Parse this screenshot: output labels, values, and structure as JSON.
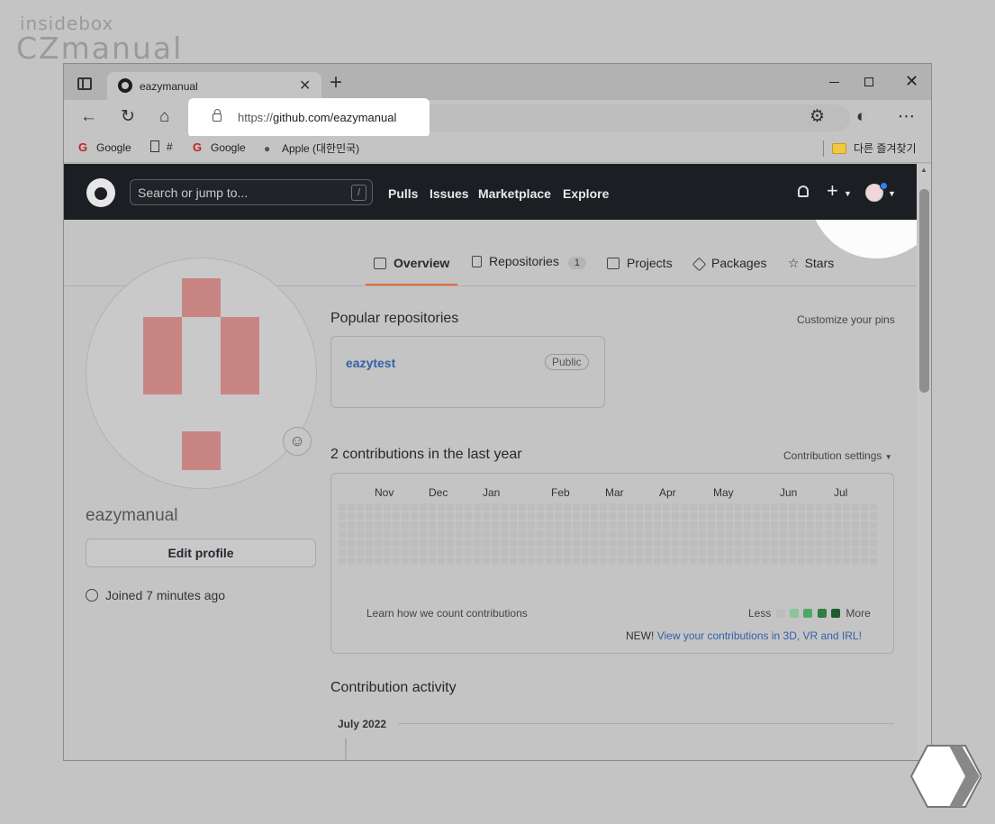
{
  "watermark": {
    "small": "insidebox",
    "big": "CZmanual"
  },
  "browser": {
    "tab_title": "eazymanual",
    "url_prefix": "https://",
    "url_host": "github.com/eazymanual",
    "bookmarks": [
      "Google",
      "#",
      "Google",
      "Apple (대한민국)"
    ],
    "other_favorites": "다른 즐겨찾기"
  },
  "github": {
    "search_placeholder": "Search or jump to...",
    "slash_key": "/",
    "nav": [
      "Pulls",
      "Issues",
      "Marketplace",
      "Explore"
    ],
    "tabs": {
      "overview": "Overview",
      "repositories": "Repositories",
      "repositories_count": "1",
      "projects": "Projects",
      "packages": "Packages",
      "stars": "Stars"
    },
    "profile": {
      "username": "eazymanual",
      "edit_button": "Edit profile",
      "joined": "Joined 7 minutes ago"
    },
    "popular": {
      "title": "Popular repositories",
      "customize": "Customize your pins",
      "repo_name": "eazytest",
      "repo_visibility": "Public"
    },
    "contributions": {
      "title": "2 contributions in the last year",
      "settings": "Contribution settings",
      "months": [
        "Nov",
        "Dec",
        "Jan",
        "Feb",
        "Mar",
        "Apr",
        "May",
        "Jun",
        "Jul"
      ],
      "learn": "Learn how we count contributions",
      "less": "Less",
      "more": "More",
      "new_prefix": "NEW!",
      "new_link": "View your contributions in 3D, VR and IRL!",
      "colors": {
        "empty": "#bdbdbd",
        "l1": "#8cc49a",
        "l2": "#4fa865",
        "l3": "#2f7d45",
        "l4": "#1e5c30"
      }
    },
    "activity": {
      "title": "Contribution activity",
      "month": "July 2022"
    }
  }
}
